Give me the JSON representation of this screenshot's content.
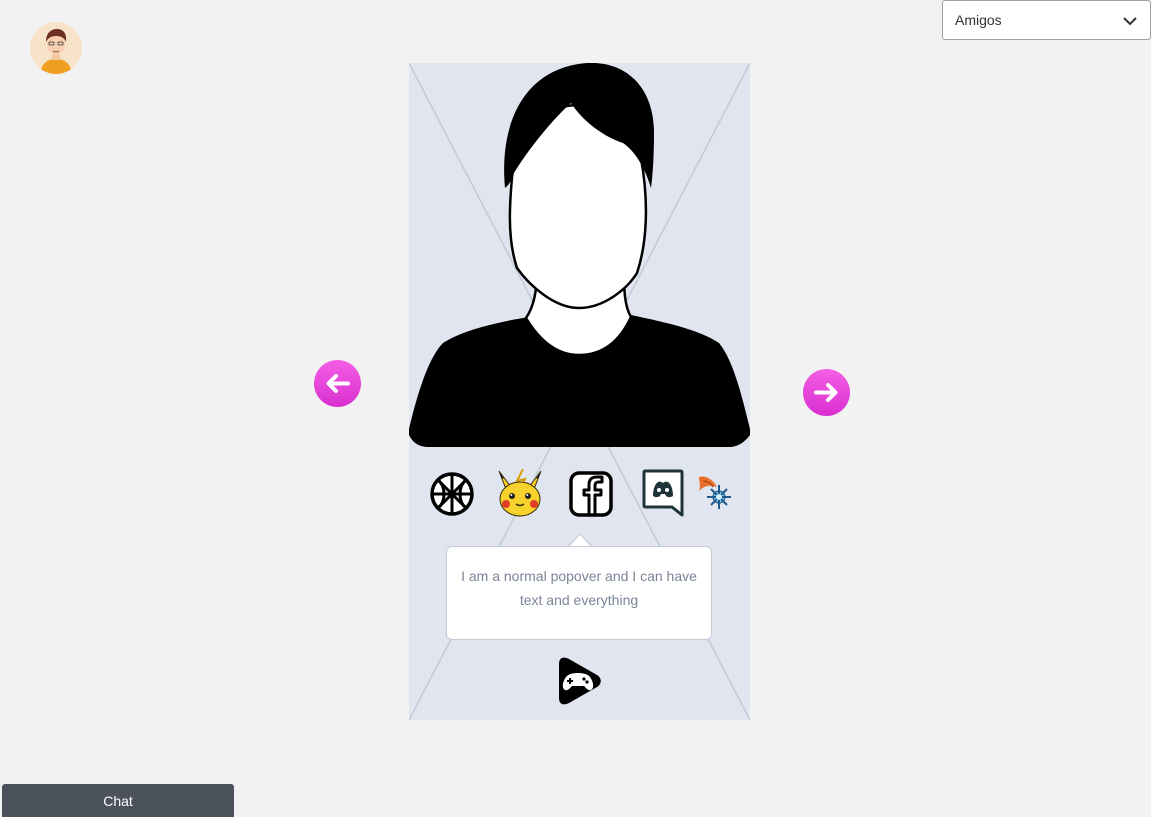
{
  "header": {
    "filter_select": {
      "value": "Amigos"
    }
  },
  "user": {
    "avatar_icon": "user-avatar-icon"
  },
  "profile_card": {
    "interest_icons": [
      "basketball-icon",
      "pikachu-icon",
      "facebook-icon",
      "discord-icon",
      "pokemon-icon"
    ],
    "popover": {
      "text": "I am a normal popover and I can have text and everything"
    },
    "bottom_icon": "gamepad-icon"
  },
  "navigation": {
    "prev_icon": "arrow-left-icon",
    "next_icon": "arrow-right-icon",
    "accent_color": "#e83fd6"
  },
  "chat": {
    "label": "Chat"
  }
}
